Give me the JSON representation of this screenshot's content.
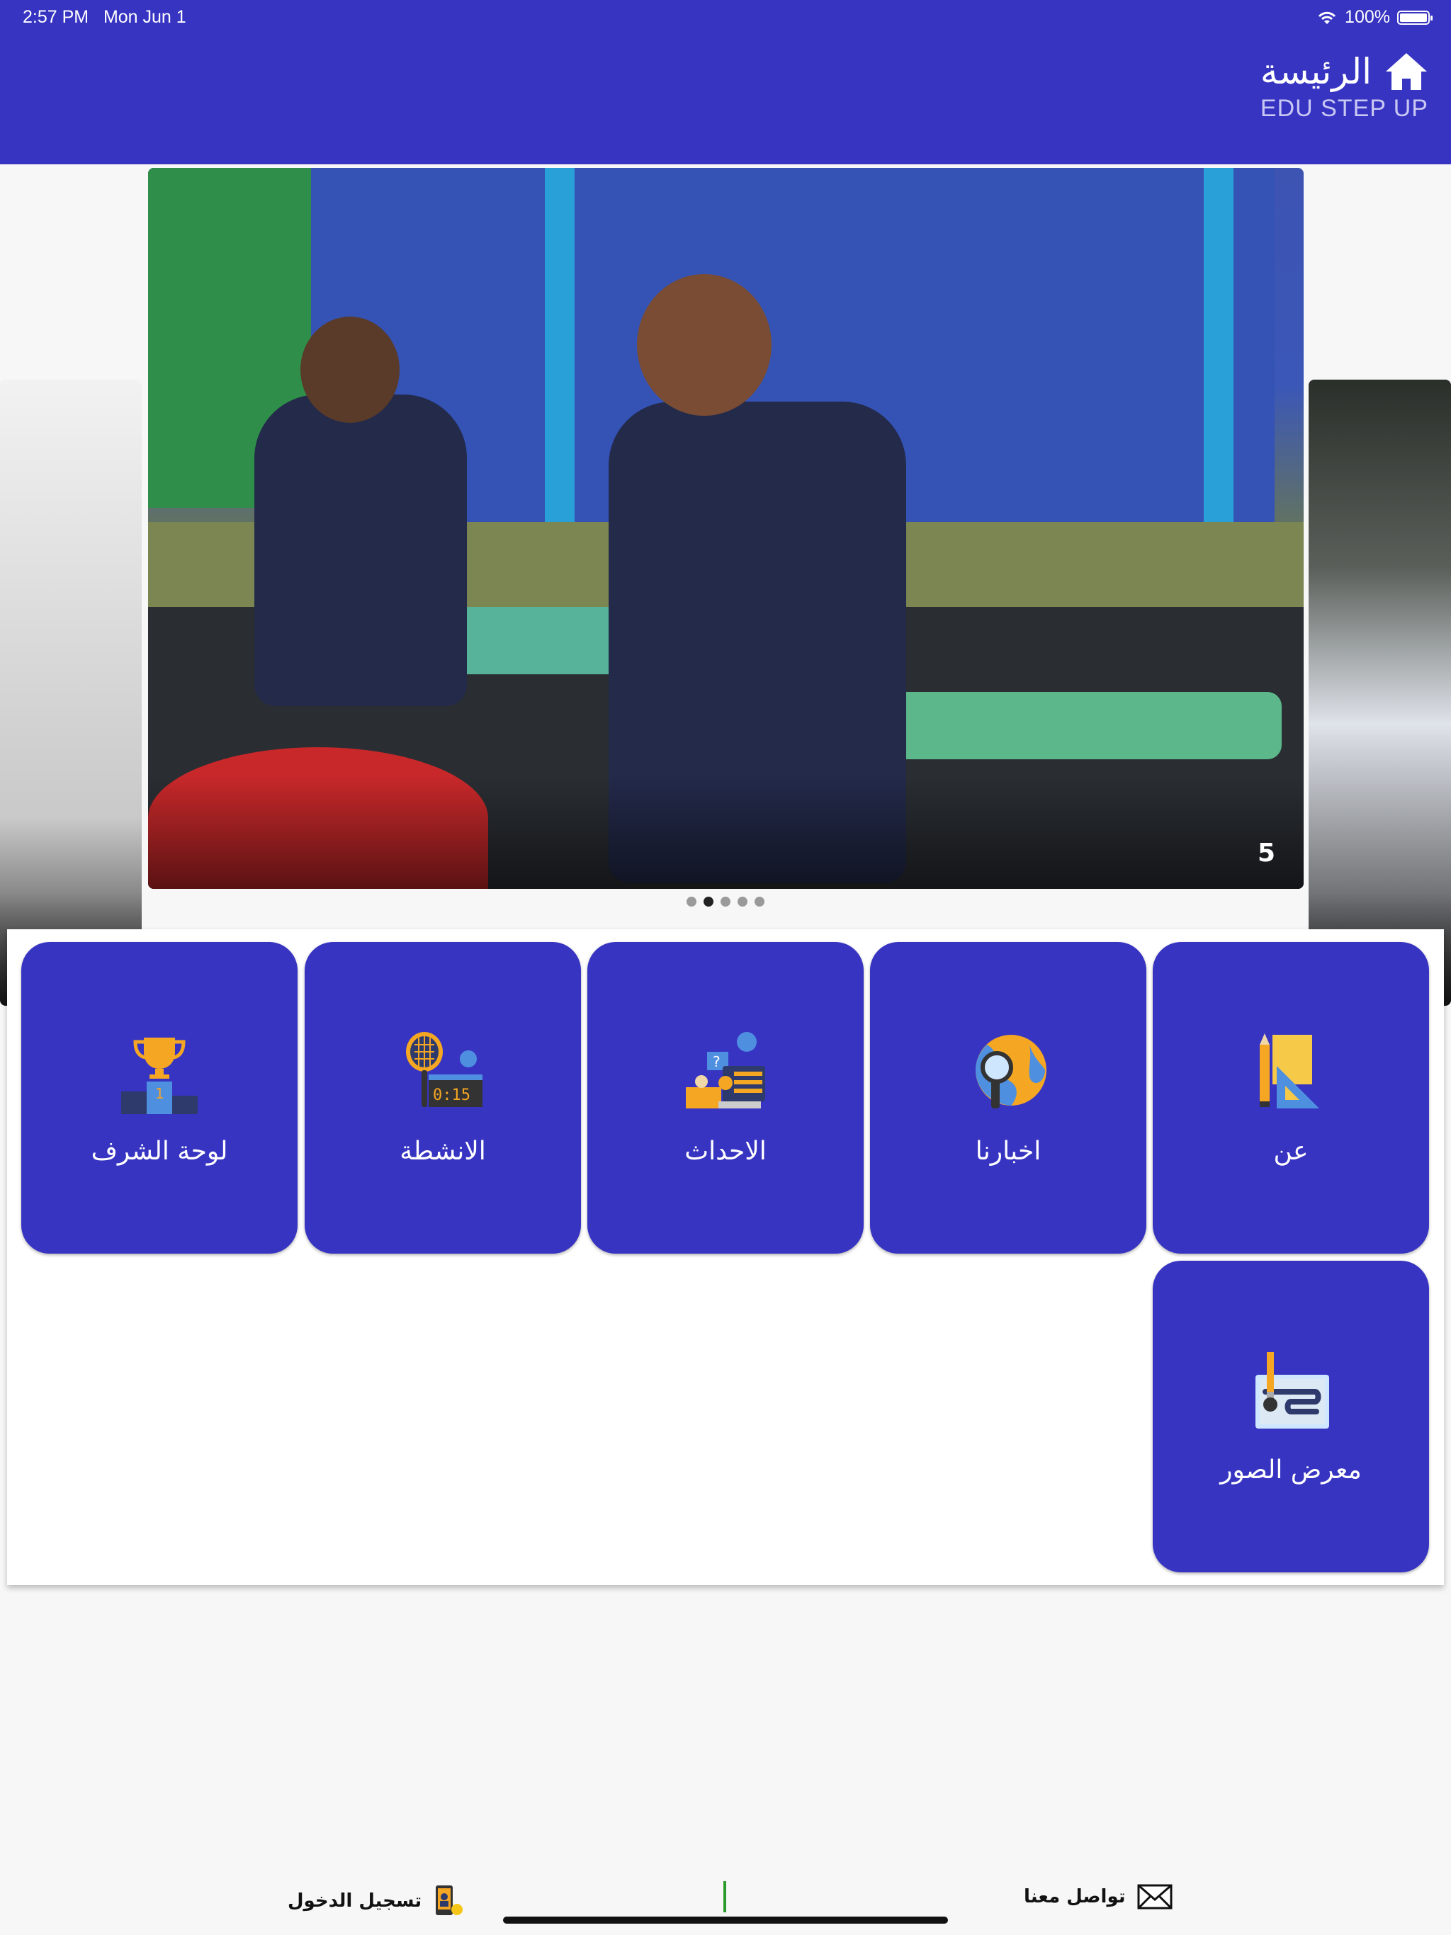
{
  "status_bar": {
    "time": "2:57 PM",
    "date": "Mon Jun 1",
    "battery": "100%"
  },
  "header": {
    "title": "الرئيسة",
    "subtitle": "EDU STEP UP",
    "icon": "home-icon"
  },
  "carousel": {
    "current_slide_label": "5",
    "dot_count": 5,
    "active_dot": 2
  },
  "menu": {
    "tiles": [
      {
        "label": "عن",
        "icon": "ruler-pencil-icon"
      },
      {
        "label": "اخبارنا",
        "icon": "globe-search-icon"
      },
      {
        "label": "الاحداث",
        "icon": "presentation-icon"
      },
      {
        "label": "الانشطة",
        "icon": "tennis-scoreboard-icon"
      },
      {
        "label": "لوحة الشرف",
        "icon": "trophy-podium-icon"
      },
      {
        "label": "معرض الصور",
        "icon": "gallery-brush-icon"
      }
    ]
  },
  "footer": {
    "contact_label": "تواصل معنا",
    "login_label": "تسجيل الدخول"
  },
  "colors": {
    "primary": "#3734c2",
    "background": "#f7f7f7",
    "divider": "#2a9a2a"
  }
}
